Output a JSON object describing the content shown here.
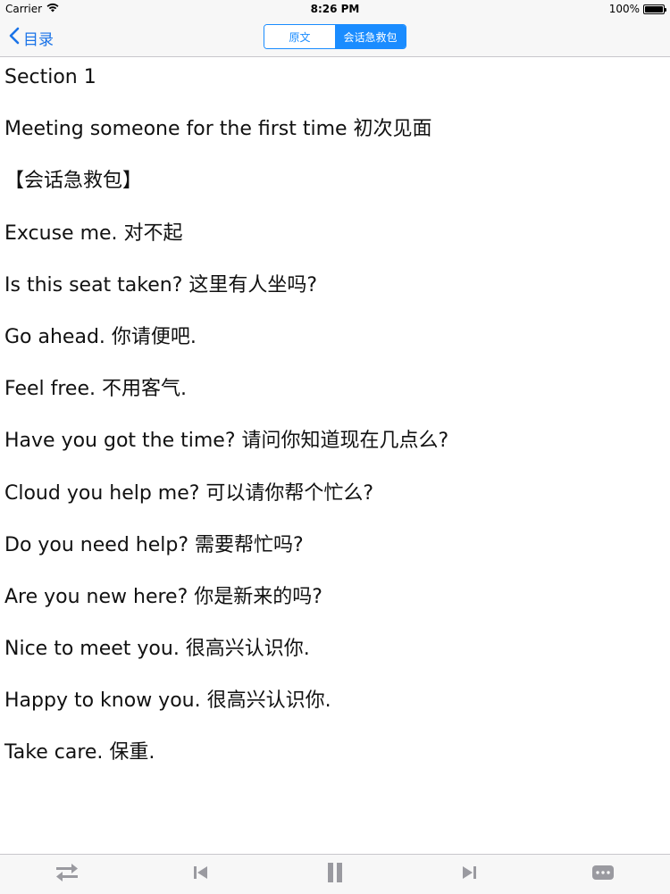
{
  "status_bar": {
    "carrier": "Carrier",
    "time": "8:26 PM",
    "battery": "100%",
    "battery_level": 1.0
  },
  "nav": {
    "back_label": "目录",
    "segments": [
      {
        "label": "原文",
        "selected": false
      },
      {
        "label": "会话急救包",
        "selected": true
      }
    ]
  },
  "content": {
    "lines": [
      "Section 1",
      "Meeting someone for the first time 初次见面",
      "【会话急救包】",
      "Excuse me. 对不起",
      "Is this seat taken? 这里有人坐吗?",
      "Go ahead. 你请便吧.",
      "Feel free. 不用客气.",
      "Have you got the time? 请问你知道现在几点么?",
      "Cloud you help me? 可以请你帮个忙么?",
      "Do you need help? 需要帮忙吗?",
      "Are you new here? 你是新来的吗?",
      "Nice to meet you. 很高兴认识你.",
      "Happy to know you. 很高兴认识你.",
      "Take care. 保重."
    ]
  },
  "toolbar": {
    "icons": [
      "shuffle-icon",
      "previous-icon",
      "pause-icon",
      "next-icon",
      "more-icon"
    ],
    "icon_color": "#9a9aa0"
  },
  "colors": {
    "accent": "#1a8cff",
    "bar_background": "#f7f7f7"
  }
}
